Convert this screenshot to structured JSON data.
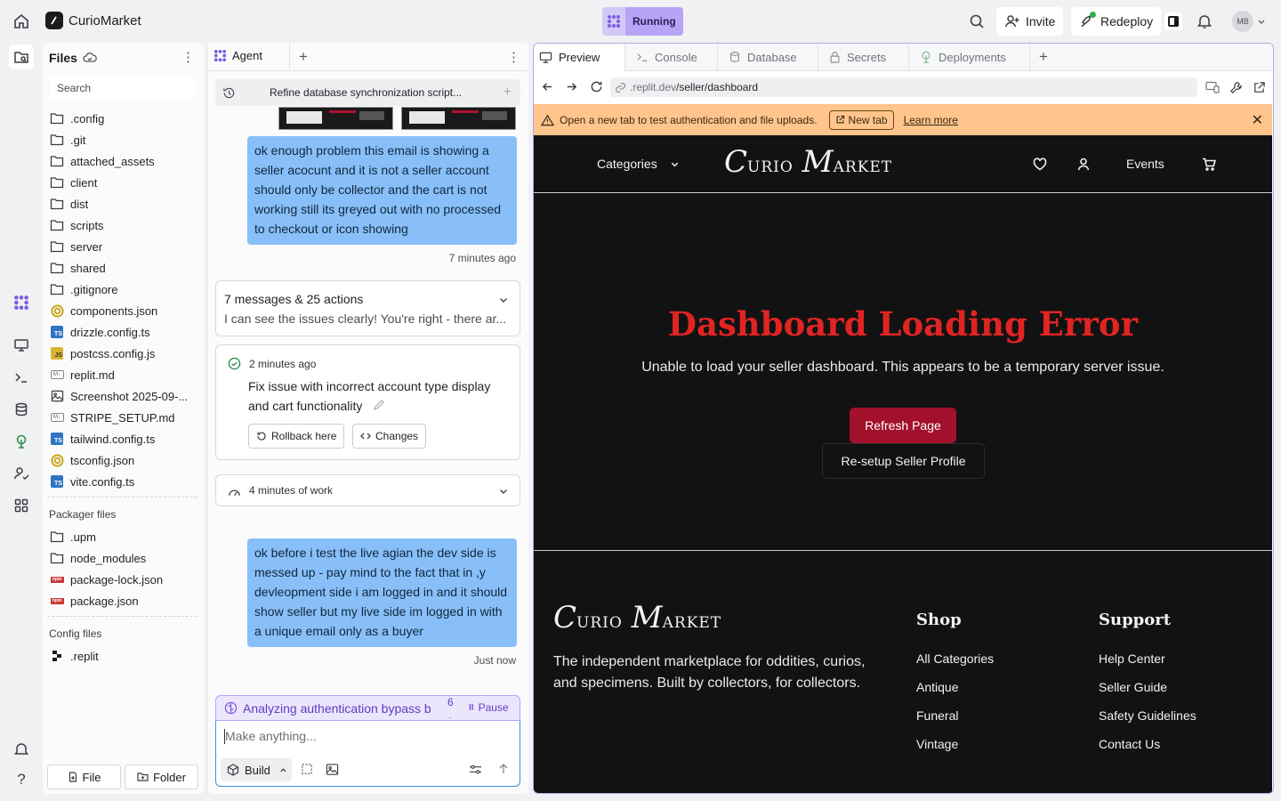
{
  "topbar": {
    "app_name": "CurioMarket",
    "status": "Running",
    "invite": "Invite",
    "redeploy": "Redeploy",
    "avatar": "MB"
  },
  "files": {
    "title": "Files",
    "search_placeholder": "Search",
    "items": [
      ".config",
      ".git",
      "attached_assets",
      "client",
      "dist",
      "scripts",
      "server",
      "shared",
      ".gitignore",
      "components.json",
      "drizzle.config.ts",
      "postcss.config.js",
      "replit.md",
      "Screenshot 2025-09-...",
      "STRIPE_SETUP.md",
      "tailwind.config.ts",
      "tsconfig.json",
      "vite.config.ts"
    ],
    "packager_label": "Packager files",
    "packager_items": [
      ".upm",
      "node_modules",
      "package-lock.json",
      "package.json"
    ],
    "config_label": "Config files",
    "config_items": [
      ".replit"
    ],
    "file_button": "File",
    "folder_button": "Folder"
  },
  "agent": {
    "tab_label": "Agent",
    "thread_title": "Refine database synchronization script...",
    "msg1": "ok enough problem this email is showing a seller acocunt and it is not a seller account should only be collector and the cart is not working still its greyed out with no processed to checkout or icon showing",
    "msg1_time": "7 minutes ago",
    "summary_title": "7 messages & 25 actions",
    "summary_preview": "I can see the issues clearly! You're right - there ar...",
    "checkpoint_time": "2 minutes ago",
    "checkpoint_text": "Fix issue with incorrect account type display and cart functionality",
    "rollback": "Rollback here",
    "changes": "Changes",
    "work_label": "4 minutes of work",
    "msg2": "ok before i test the live agian the dev side is messed up - pay mind to the fact that in ,y devleopment side i am logged in and it should show seller but my live side im logged in with a unique email only as a buyer",
    "msg2_time": "Just now",
    "status_text": "Analyzing authentication bypass b",
    "status_seconds": "6 s",
    "pause": "Pause",
    "input_placeholder": "Make anything...",
    "build": "Build"
  },
  "preview": {
    "tabs": [
      "Preview",
      "Console",
      "Database",
      "Secrets",
      "Deployments"
    ],
    "url_host": ".replit.dev",
    "url_path": "/seller/dashboard",
    "banner_text": "Open a new tab to test authentication and file uploads.",
    "banner_button": "New tab",
    "banner_link": "Learn more"
  },
  "site": {
    "nav_categories": "Categories",
    "logo_c": "C",
    "logo_urio": "URIO",
    "logo_m": "M",
    "logo_arket": "ARKET",
    "nav_events": "Events",
    "error_title": "Dashboard Loading Error",
    "error_message": "Unable to load your seller dashboard. This appears to be a temporary server issue.",
    "refresh_button": "Refresh Page",
    "resetup_button": "Re-setup Seller Profile",
    "footer_tagline": "The independent marketplace for oddities, curios, and specimens. Built by collectors, for collectors.",
    "shop_heading": "Shop",
    "shop_links": [
      "All Categories",
      "Antique",
      "Funeral",
      "Vintage"
    ],
    "support_heading": "Support",
    "support_links": [
      "Help Center",
      "Seller Guide",
      "Safety Guidelines",
      "Contact Us"
    ]
  },
  "colors": {
    "accent_purple": "#b8a4f5",
    "user_bubble": "#88bff8",
    "banner_bg": "#ffc58d",
    "error_red": "#e02424",
    "refresh_bg": "#a3102b",
    "site_bg": "#121212"
  }
}
